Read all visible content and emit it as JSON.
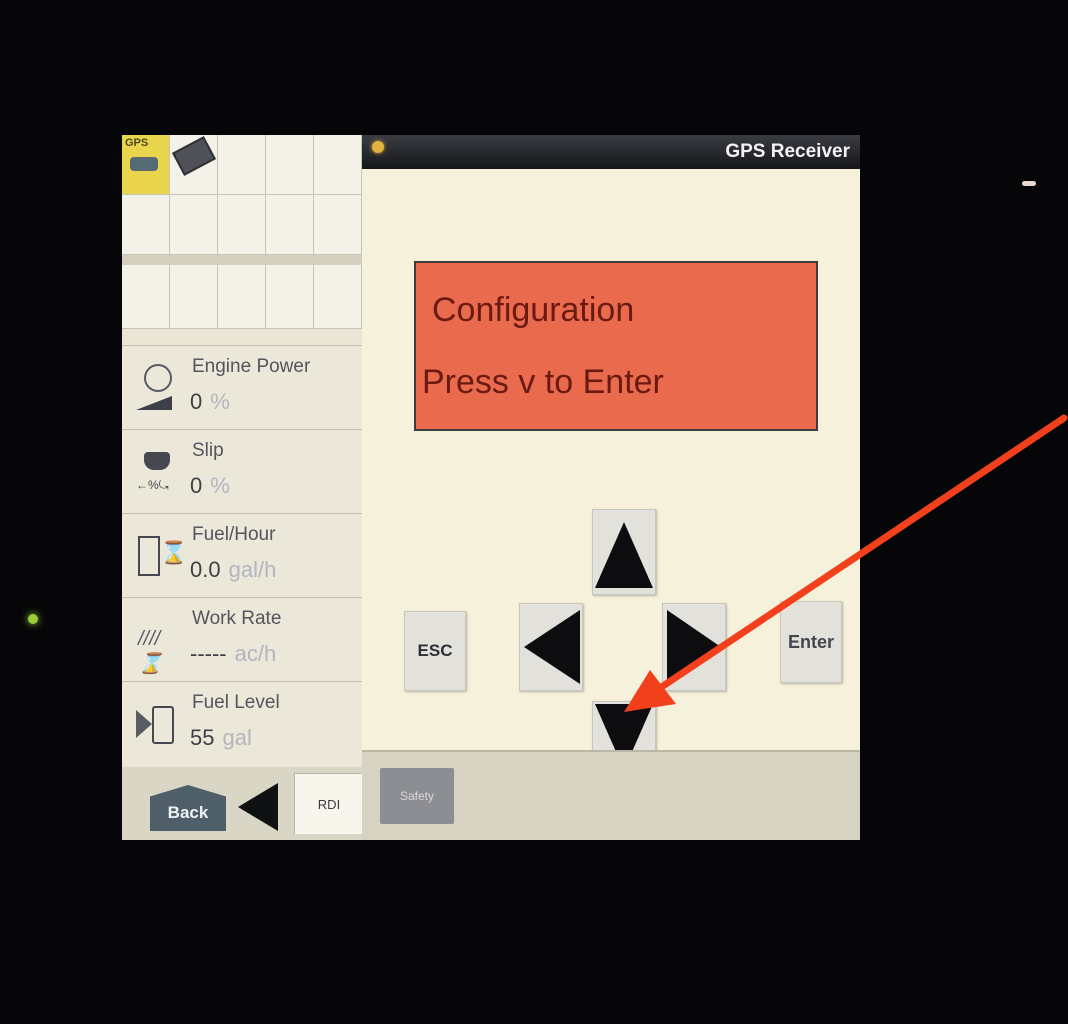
{
  "header": {
    "title": "GPS Receiver"
  },
  "shortcuts": {
    "gps_label": "GPS"
  },
  "gauges": [
    {
      "label": "Engine Power",
      "value": "0",
      "unit": "%"
    },
    {
      "label": "Slip",
      "value": "0",
      "unit": "%"
    },
    {
      "label": "Fuel/Hour",
      "value": "0.0",
      "unit": "gal/h"
    },
    {
      "label": "Work Rate",
      "value": "-----",
      "unit": "ac/h"
    },
    {
      "label": "Fuel Level",
      "value": "55",
      "unit": "gal"
    }
  ],
  "display": {
    "line1": "Configuration",
    "line2": "Press v to Enter"
  },
  "keys": {
    "esc": "ESC",
    "enter": "Enter"
  },
  "footer": {
    "back": "Back",
    "rdi": "RDI",
    "safety": "Safety"
  },
  "colors": {
    "display_background": "#ea6a4e",
    "annotation_arrow": "#f2401c",
    "title_bar": "#16171b"
  },
  "icons": [
    "gps-icon",
    "book-icon",
    "info-icon",
    "engine-icon",
    "slip-icon",
    "fuel-hour-icon",
    "work-rate-icon",
    "fuel-level-icon",
    "up-arrow-icon",
    "down-arrow-icon",
    "left-arrow-icon",
    "right-arrow-icon",
    "back-arrow-icon",
    "annotation-arrow"
  ]
}
